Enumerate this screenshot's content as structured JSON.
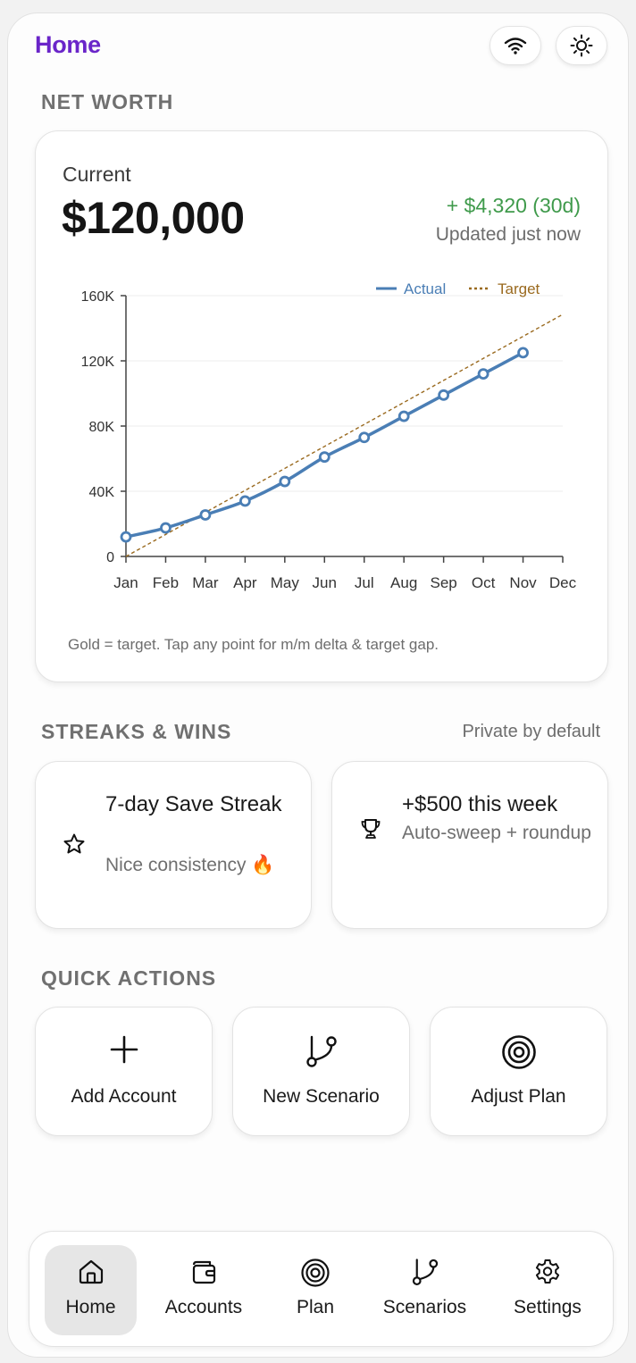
{
  "header": {
    "title": "Home",
    "wifi_icon": "wifi-icon",
    "theme_icon": "sun-icon"
  },
  "net_worth": {
    "section_title": "NET WORTH",
    "current_label": "Current",
    "current_value": "$120,000",
    "change": "+ $4,320 (30d)",
    "updated": "Updated just now",
    "caption": "Gold = target. Tap any point for m/m delta & target gap.",
    "colors": {
      "actual": "#4a7eb5",
      "target": "#9a6a1f",
      "change_positive": "#3f9a4b"
    }
  },
  "chart_data": {
    "type": "line",
    "x": [
      "Jan",
      "Feb",
      "Mar",
      "Apr",
      "May",
      "Jun",
      "Jul",
      "Aug",
      "Sep",
      "Oct",
      "Nov",
      "Dec"
    ],
    "yticks": [
      "0",
      "40K",
      "80K",
      "120K",
      "160K"
    ],
    "ylim": [
      0,
      160000
    ],
    "grid": true,
    "legend": "top-right",
    "series": [
      {
        "name": "Actual",
        "style": "solid",
        "color": "#4a7eb5",
        "values": [
          12000,
          17500,
          25500,
          34000,
          46000,
          61000,
          73000,
          86000,
          99000,
          112000,
          125000,
          null
        ]
      },
      {
        "name": "Target",
        "style": "dotted",
        "color": "#9a6a1f",
        "values": [
          0,
          13500,
          27000,
          40500,
          54000,
          67500,
          81000,
          94500,
          108000,
          121500,
          135000,
          148500
        ]
      }
    ]
  },
  "streaks": {
    "section_title": "STREAKS & WINS",
    "note": "Private by default",
    "items": [
      {
        "icon": "star-icon",
        "title": "7-day Save Streak",
        "subtitle": "Nice consistency 🔥"
      },
      {
        "icon": "trophy-icon",
        "title": "+$500 this week",
        "subtitle": "Auto-sweep + roundup"
      }
    ]
  },
  "quick_actions": {
    "section_title": "QUICK ACTIONS",
    "items": [
      {
        "icon": "plus-icon",
        "label": "Add Account"
      },
      {
        "icon": "branch-icon",
        "label": "New Scenario"
      },
      {
        "icon": "target-icon",
        "label": "Adjust Plan"
      }
    ]
  },
  "tabbar": {
    "active": "Home",
    "items": [
      {
        "icon": "home-icon",
        "label": "Home"
      },
      {
        "icon": "wallet-icon",
        "label": "Accounts"
      },
      {
        "icon": "target-icon",
        "label": "Plan"
      },
      {
        "icon": "branch-icon",
        "label": "Scenarios"
      },
      {
        "icon": "gear-icon",
        "label": "Settings"
      }
    ]
  }
}
